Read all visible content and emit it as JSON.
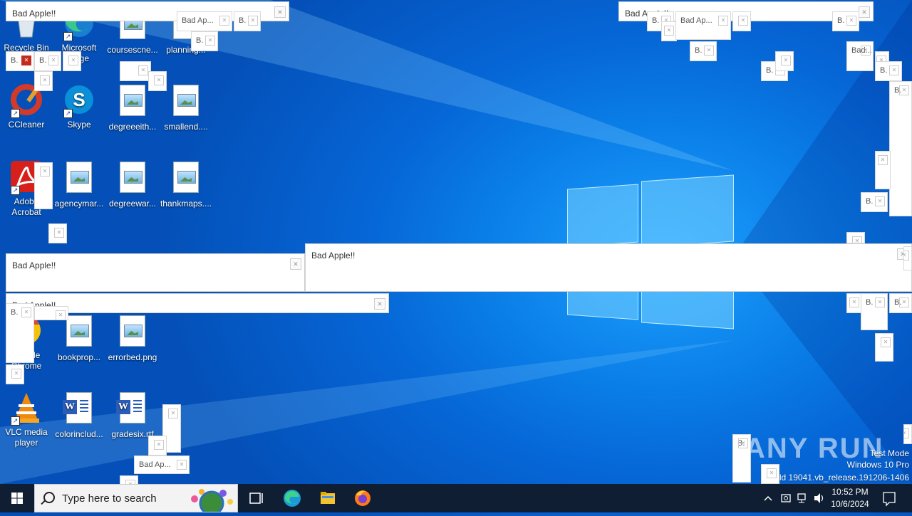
{
  "desktop_icons": [
    {
      "label": "Recycle Bin",
      "kind": "recycle"
    },
    {
      "label": "Microsoft Edge",
      "kind": "edge"
    },
    {
      "label": "coursescne...",
      "kind": "doc"
    },
    {
      "label": "planning...",
      "kind": "doc"
    },
    {
      "label": "CCleaner",
      "kind": "ccleaner"
    },
    {
      "label": "Skype",
      "kind": "skype"
    },
    {
      "label": "degreeeith...",
      "kind": "doc"
    },
    {
      "label": "smallend....",
      "kind": "doc"
    },
    {
      "label": "Adobe Acrobat",
      "kind": "acrobat"
    },
    {
      "label": "agencymar...",
      "kind": "doc"
    },
    {
      "label": "degreewar...",
      "kind": "doc"
    },
    {
      "label": "thankmaps....",
      "kind": "doc"
    },
    {
      "label": "Google Chrome",
      "kind": "chrome"
    },
    {
      "label": "bookprop...",
      "kind": "doc"
    },
    {
      "label": "errorbed.png",
      "kind": "doc"
    },
    {
      "label": "VLC media player",
      "kind": "vlc"
    },
    {
      "label": "colorinclud...",
      "kind": "word"
    },
    {
      "label": "gradesix.rtf",
      "kind": "word"
    }
  ],
  "popups": {
    "title": "Bad Apple!!",
    "short_title": "Bad Ap...",
    "fragment_title": "B.",
    "fragment_title_alt": "Bad..."
  },
  "watermark": {
    "mode": "Test Mode",
    "edition": "Windows 10 Pro",
    "build": "Build 19041.vb_release.191206-1406"
  },
  "anyrun": "ANY RUN",
  "taskbar": {
    "search_placeholder": "Type here to search",
    "pinned": [
      "Task View",
      "Microsoft Edge",
      "File Explorer",
      "Firefox"
    ],
    "time": "10:52 PM",
    "date": "10/6/2024"
  },
  "colors": {
    "desktop": "#0a7fe8",
    "taskbar": "#0f1e33",
    "popup_bg": "#ffffff"
  }
}
